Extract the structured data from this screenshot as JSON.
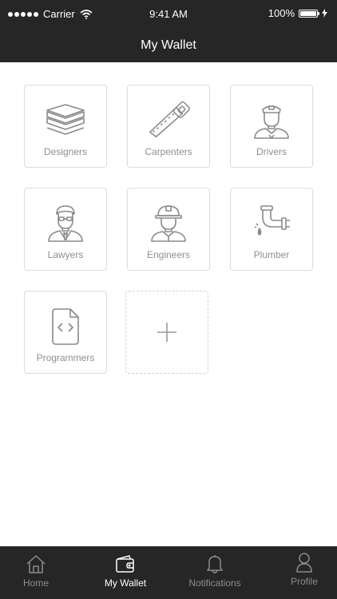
{
  "status_bar": {
    "carrier": "Carrier",
    "time": "9:41 AM",
    "battery": "100%"
  },
  "nav": {
    "title": "My Wallet"
  },
  "tiles": [
    {
      "label": "Designers",
      "icon": "stacked-layers-icon"
    },
    {
      "label": "Carpenters",
      "icon": "saw-icon"
    },
    {
      "label": "Drivers",
      "icon": "driver-icon"
    },
    {
      "label": "Lawyers",
      "icon": "lawyer-icon"
    },
    {
      "label": "Engineers",
      "icon": "engineer-icon"
    },
    {
      "label": "Plumber",
      "icon": "pipe-icon"
    },
    {
      "label": "Programmers",
      "icon": "code-file-icon"
    }
  ],
  "add_tile": {
    "icon": "plus-icon"
  },
  "tabs": [
    {
      "label": "Home",
      "icon": "home-icon",
      "active": false
    },
    {
      "label": "My Wallet",
      "icon": "wallet-icon",
      "active": true
    },
    {
      "label": "Notifications",
      "icon": "bell-icon",
      "active": false
    },
    {
      "label": "Profile",
      "icon": "person-icon",
      "active": false
    }
  ],
  "colors": {
    "bar_background": "#262626",
    "tile_border": "#dcdcdc",
    "icon_stroke": "#8a8a8a",
    "label_gray": "#8f8f8f",
    "tab_inactive": "#8c8c8c",
    "tab_active": "#ffffff"
  }
}
